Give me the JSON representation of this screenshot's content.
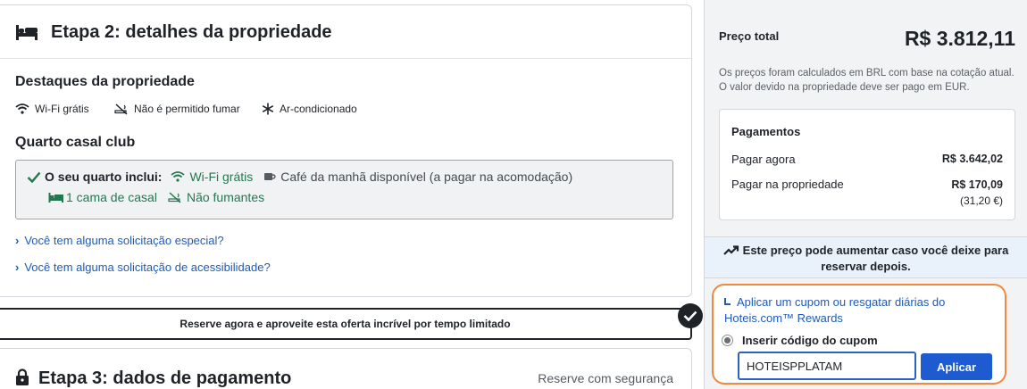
{
  "step2": {
    "title": "Etapa 2: detalhes da propriedade",
    "highlights_title": "Destaques da propriedade",
    "amenities": [
      "Wi-Fi grátis",
      "Não é permitido fumar",
      "Ar-condicionado"
    ],
    "room_title": "Quarto casal club",
    "room_includes_label": "O seu quarto inclui:",
    "room_includes": [
      "Wi-Fi grátis",
      "Café da manhã disponível (a pagar na acomodação)",
      "1 cama de casal",
      "Não fumantes"
    ],
    "links": [
      "Você tem alguma solicitação especial?",
      "Você tem alguma solicitação de acessibilidade?"
    ]
  },
  "banner": {
    "text": "Reserve agora e aproveite esta oferta incrível por tempo limitado"
  },
  "step3": {
    "title": "Etapa 3: dados de pagamento",
    "secure_text": "Reserve com segurança"
  },
  "summary": {
    "total_label": "Preço total",
    "total_value": "R$ 3.812,11",
    "note": "Os preços foram calculados em BRL com base na cotação atual. O valor devido na propriedade deve ser pago em EUR.",
    "payments_title": "Pagamentos",
    "pay_now_label": "Pagar agora",
    "pay_now_value": "R$ 3.642,02",
    "pay_property_label": "Pagar na propriedade",
    "pay_property_value": "R$ 170,09",
    "pay_property_eur": "(31,20 €)",
    "warning": "Este preço pode aumentar caso você deixe para reservar depois."
  },
  "coupon": {
    "link_text": "Aplicar um cupom ou resgatar diárias do Hoteis.com™ Rewards",
    "radio_label": "Inserir código do cupom",
    "input_value": "HOTEISPPLATAM",
    "apply_label": "Aplicar"
  },
  "colors": {
    "link": "#1e5bb8",
    "green": "#227950",
    "button": "#1e5bd0",
    "highlight_border": "#f0883e"
  }
}
